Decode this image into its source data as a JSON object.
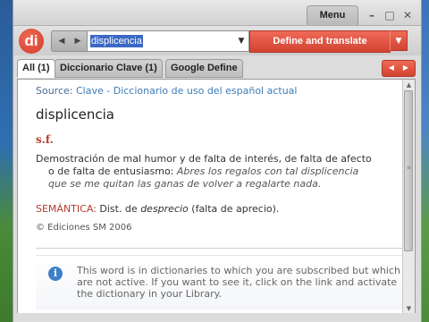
{
  "window": {
    "menu_label": "Menu",
    "controls": {
      "minimize": "–",
      "maximize": "□",
      "close": "✕"
    }
  },
  "toolbar": {
    "logo_text": "di",
    "nav_back": "◀",
    "nav_forward": "▶",
    "search_value": "displicencia",
    "search_dropdown": "▼",
    "translate_label": "Define and translate",
    "translate_dropdown": "▼"
  },
  "tabs": {
    "items": [
      {
        "label": "All (1)",
        "active": true
      },
      {
        "label": "Diccionario Clave (1)",
        "active": false
      },
      {
        "label": "Google Define",
        "active": false
      }
    ],
    "prev": "◀",
    "next": "▶"
  },
  "entry": {
    "source_label": "Source:",
    "source_name": "Clave - Diccionario de uso del español actual",
    "headword": "displicencia",
    "pos": "s.f.",
    "definition_line1": "Demostración de mal humor y de falta de interés, de falta de afecto",
    "definition_line2": "o de falta de entusiasmo:",
    "example_part1": "Abres los regalos con tal displicencia",
    "example_part2": "que se me quitan las ganas de volver a regalarte nada.",
    "semantica_label": "SEMÁNTICA:",
    "semantica_pre": "Dist. de",
    "semantica_em": "desprecio",
    "semantica_post": "(falta de aprecio).",
    "copyright": "© Ediciones SM 2006"
  },
  "notice": {
    "icon": "i",
    "text": "This word is in dictionaries to which you are subscribed but which are not active. If you want to see it, click on the link and activate the dictionary in your Library."
  },
  "colors": {
    "accent_red": "#d24331",
    "pos_red": "#b53a2c",
    "source_blue": "#3c7db8",
    "info_blue": "#3f7fc9"
  }
}
